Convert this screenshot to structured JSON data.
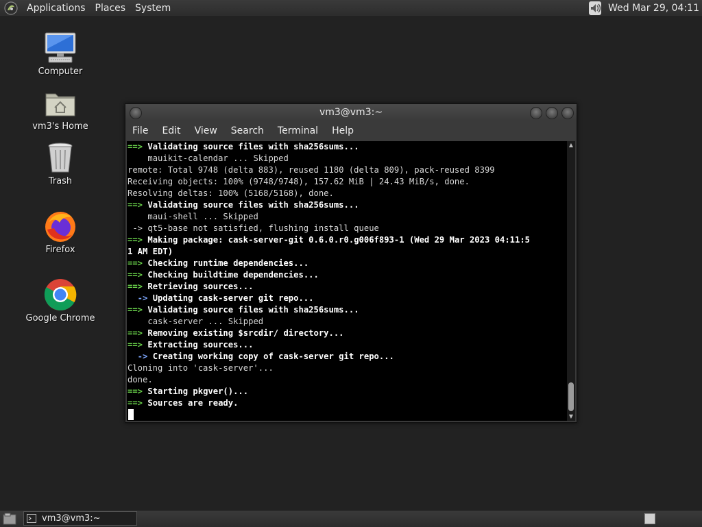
{
  "top_panel": {
    "menus": [
      "Applications",
      "Places",
      "System"
    ],
    "clock": "Wed Mar 29, 04:11",
    "icons": {
      "menu": "distro-logo-icon",
      "volume": "volume-icon"
    }
  },
  "desktop": {
    "icons": [
      {
        "name": "computer",
        "label": "Computer"
      },
      {
        "name": "home",
        "label": "vm3's Home"
      },
      {
        "name": "trash",
        "label": "Trash"
      },
      {
        "name": "firefox",
        "label": "Firefox"
      },
      {
        "name": "chrome",
        "label": "Google Chrome"
      }
    ]
  },
  "terminal": {
    "title": "vm3@vm3:~",
    "menu": [
      "File",
      "Edit",
      "View",
      "Search",
      "Terminal",
      "Help"
    ],
    "lines": [
      {
        "type": "marker",
        "text": "Validating source files with sha256sums..."
      },
      {
        "type": "plain",
        "indent": 4,
        "text": "mauikit-calendar ... Skipped"
      },
      {
        "type": "plain",
        "indent": 0,
        "text": "remote: Total 9748 (delta 883), reused 1180 (delta 809), pack-reused 8399"
      },
      {
        "type": "plain",
        "indent": 0,
        "text": "Receiving objects: 100% (9748/9748), 157.62 MiB | 24.43 MiB/s, done."
      },
      {
        "type": "plain",
        "indent": 0,
        "text": "Resolving deltas: 100% (5168/5168), done."
      },
      {
        "type": "marker",
        "text": "Validating source files with sha256sums..."
      },
      {
        "type": "plain",
        "indent": 4,
        "text": "maui-shell ... Skipped"
      },
      {
        "type": "plain",
        "indent": 0,
        "text": " -> qt5-base not satisfied, flushing install queue"
      },
      {
        "type": "marker",
        "text": "Making package: cask-server-git 0.6.0.r0.g006f893-1 (Wed 29 Mar 2023 04:11:5"
      },
      {
        "type": "bold",
        "indent": 0,
        "text": "1 AM EDT)"
      },
      {
        "type": "marker",
        "text": "Checking runtime dependencies..."
      },
      {
        "type": "marker",
        "text": "Checking buildtime dependencies..."
      },
      {
        "type": "marker",
        "text": "Retrieving sources..."
      },
      {
        "type": "arrow",
        "text": "Updating cask-server git repo..."
      },
      {
        "type": "marker",
        "text": "Validating source files with sha256sums..."
      },
      {
        "type": "plain",
        "indent": 4,
        "text": "cask-server ... Skipped"
      },
      {
        "type": "marker",
        "text": "Removing existing $srcdir/ directory..."
      },
      {
        "type": "marker",
        "text": "Extracting sources..."
      },
      {
        "type": "arrow",
        "text": "Creating working copy of cask-server git repo..."
      },
      {
        "type": "plain",
        "indent": 0,
        "text": "Cloning into 'cask-server'..."
      },
      {
        "type": "plain",
        "indent": 0,
        "text": "done."
      },
      {
        "type": "marker",
        "text": "Starting pkgver()..."
      },
      {
        "type": "marker",
        "text": "Sources are ready."
      }
    ],
    "marker": "==>",
    "arrow": "->",
    "colors": {
      "marker": "#69d14a",
      "arrow": "#7ea8ff",
      "background": "#000000",
      "text": "#d8d8d8"
    }
  },
  "bottom_panel": {
    "task": "vm3@vm3:~"
  }
}
